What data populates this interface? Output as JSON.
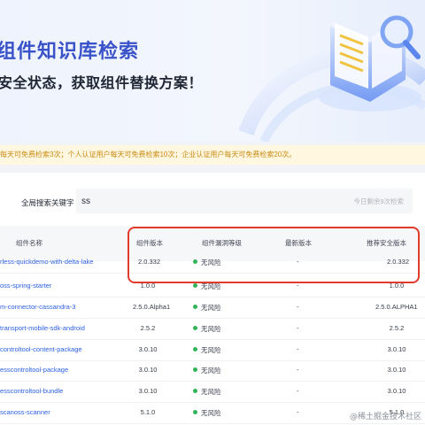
{
  "banner": {
    "title": "组件知识库检索",
    "subtitle": "安全状态，获取组件替换方案！"
  },
  "notice": {
    "text": "每天可免费检索3次；个人认证用户每天可免费检索10次；企业认证用户每天可免费检索20次。"
  },
  "search": {
    "label": "全局搜索关键字",
    "value": "ss",
    "quota": "今日剩余9次检索"
  },
  "table": {
    "headers": {
      "name": "组件名称",
      "version": "组件版本",
      "vuln_level": "组件漏洞等级",
      "latest": "最新版本",
      "safe_version": "推荐安全版本"
    },
    "rows": [
      {
        "name": "rless-quickdemo-with-delta-lake",
        "version": "2.0.332",
        "level": "无风险",
        "latest": "-",
        "safe": "2.0.332"
      },
      {
        "name": "oss-spring-starter",
        "version": "1.0.0",
        "level": "无风险",
        "latest": "-",
        "safe": "1.0.0"
      },
      {
        "name": "m-connector-cassandra-3",
        "version": "2.5.0.Alpha1",
        "level": "无风险",
        "latest": "-",
        "safe": "2.5.0.ALPHA1"
      },
      {
        "name": "transport-mobile-sdk-android",
        "version": "2.5.2",
        "level": "无风险",
        "latest": "-",
        "safe": "2.5.2"
      },
      {
        "name": "controltool-content-package",
        "version": "3.0.10",
        "level": "无风险",
        "latest": "-",
        "safe": "3.0.10"
      },
      {
        "name": "esscontroltool-package",
        "version": "3.0.10",
        "level": "无风险",
        "latest": "-",
        "safe": "3.0.10"
      },
      {
        "name": "esscontroltool-bundle",
        "version": "3.0.10",
        "level": "无风险",
        "latest": "-",
        "safe": "3.0.10"
      },
      {
        "name": "scanoss-scanner",
        "version": "5.1.0",
        "level": "无风险",
        "latest": "-",
        "safe": "5.1.0"
      }
    ]
  },
  "watermark": "@稀土掘金技术社区",
  "colors": {
    "brand": "#3a53c8",
    "link": "#2b5fe0",
    "safe_dot": "#32b35a",
    "notice_bg": "#fff7e0",
    "notice_text": "#c98a12",
    "highlight": "#e23b2c"
  }
}
